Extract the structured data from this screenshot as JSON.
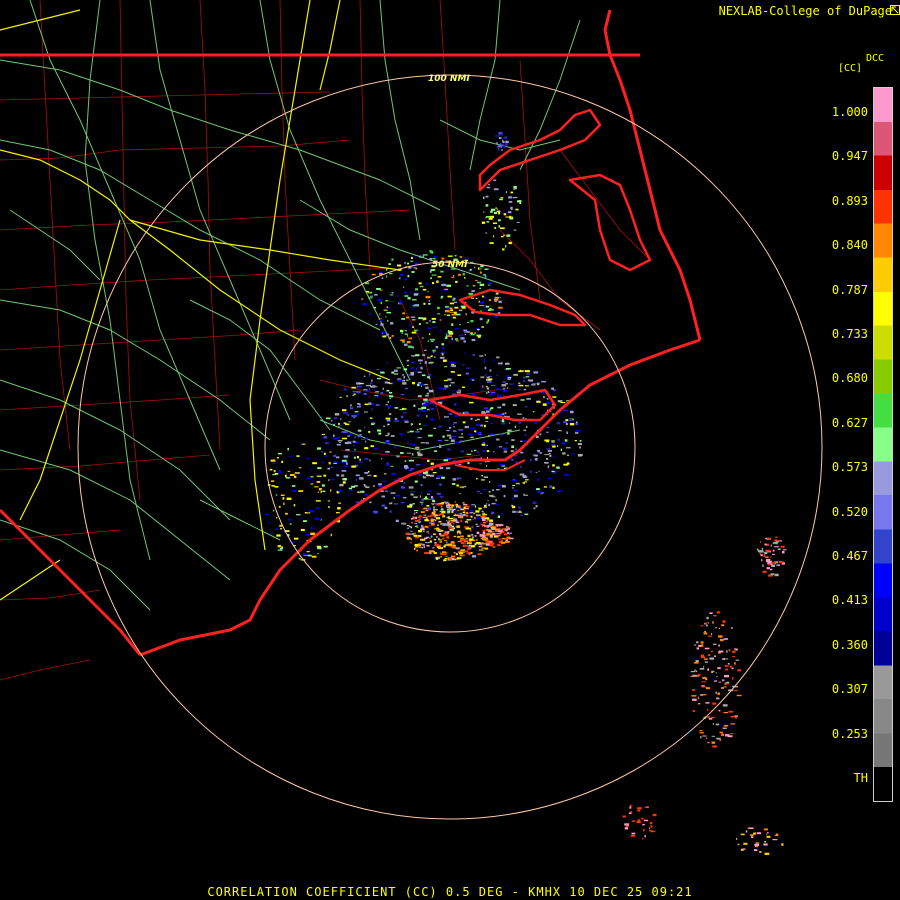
{
  "credit": "NEXLAB-College of DuPage",
  "credit_icon": "cursor-arrow-icon",
  "scale": {
    "title": "DCC",
    "unit": "[CC]",
    "ticks": [
      "1.000",
      "0.947",
      "0.893",
      "0.840",
      "0.787",
      "0.733",
      "0.680",
      "0.627",
      "0.573",
      "0.520",
      "0.467",
      "0.413",
      "0.360",
      "0.307",
      "0.253",
      "TH"
    ],
    "colors": [
      "#ff99cc",
      "#dd5577",
      "#cc0000",
      "#ff3300",
      "#ff8800",
      "#ffcc00",
      "#ffff00",
      "#ccdd00",
      "#88cc00",
      "#44dd44",
      "#88ff88",
      "#9999dd",
      "#7777ee",
      "#3344cc",
      "#0000ff",
      "#0000cc",
      "#000099",
      "#999999",
      "#888888",
      "#777777",
      "#000000"
    ]
  },
  "range_rings": {
    "inner_label": "50 NMI",
    "outer_label": "100 NMI"
  },
  "footer": "CORRELATION COEFFICIENT (CC) 0.5 DEG - KMHX 10 DEC 25 09:21",
  "colors": {
    "state_border": "#ff2020",
    "county_line": "#b01010",
    "highway": "#ffff44",
    "road": "#88ee88",
    "ring": "#ffc0a0",
    "text": "#ffff00"
  }
}
